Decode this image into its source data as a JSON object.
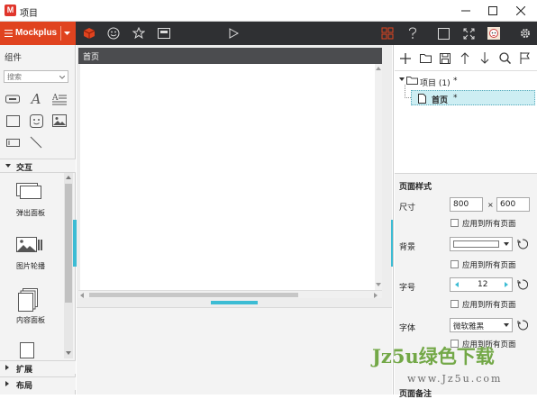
{
  "window": {
    "title": "项目"
  },
  "app_logo": "M",
  "brand": {
    "label": "Mockplus"
  },
  "left_panel": {
    "title": "组件",
    "search_placeholder": "搜索",
    "interaction_section": "交互",
    "interaction_items": [
      "弹出面板",
      "图片轮播",
      "内容面板"
    ],
    "expand_section": "扩展",
    "layout_section": "布局"
  },
  "canvas": {
    "tab_label": "首页"
  },
  "tree": {
    "project_label": "项目 (1)",
    "project_star": "*",
    "page_label": "首页",
    "page_star": "*"
  },
  "props": {
    "section_title": "页面样式",
    "size_label": "尺寸",
    "width_value": "800",
    "times": "×",
    "height_value": "600",
    "apply_all": "应用到所有页面",
    "background_label": "背景",
    "font_size_label": "字号",
    "font_size_value": "12",
    "font_label": "字体",
    "font_value": "微软雅黑",
    "notes_label": "页面备注"
  },
  "watermark": {
    "main": "Jz5u绿色下载",
    "url": "www.Jz5u.com"
  },
  "colors": {
    "brand": "#e0431f",
    "toolbar": "#2f3033",
    "accent": "#3cbcd4",
    "selection": "#cdeef3",
    "logo": "#e0352b"
  }
}
